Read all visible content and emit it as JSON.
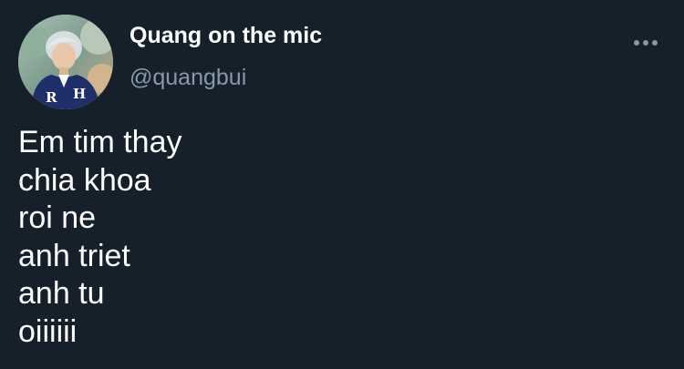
{
  "author": {
    "display_name": "Quang on the mic",
    "handle": "@quangbui"
  },
  "icons": {
    "more": "more-horizontal-icon",
    "avatar": "profile-photo"
  },
  "tweet": {
    "lines": [
      "Em tim thay",
      "chia khoa",
      "roi ne",
      "anh triet",
      "anh tu",
      "oiiiiii"
    ]
  },
  "colors": {
    "background": "#15202b",
    "primary_text": "#ffffff",
    "secondary_text": "#8899a6"
  }
}
